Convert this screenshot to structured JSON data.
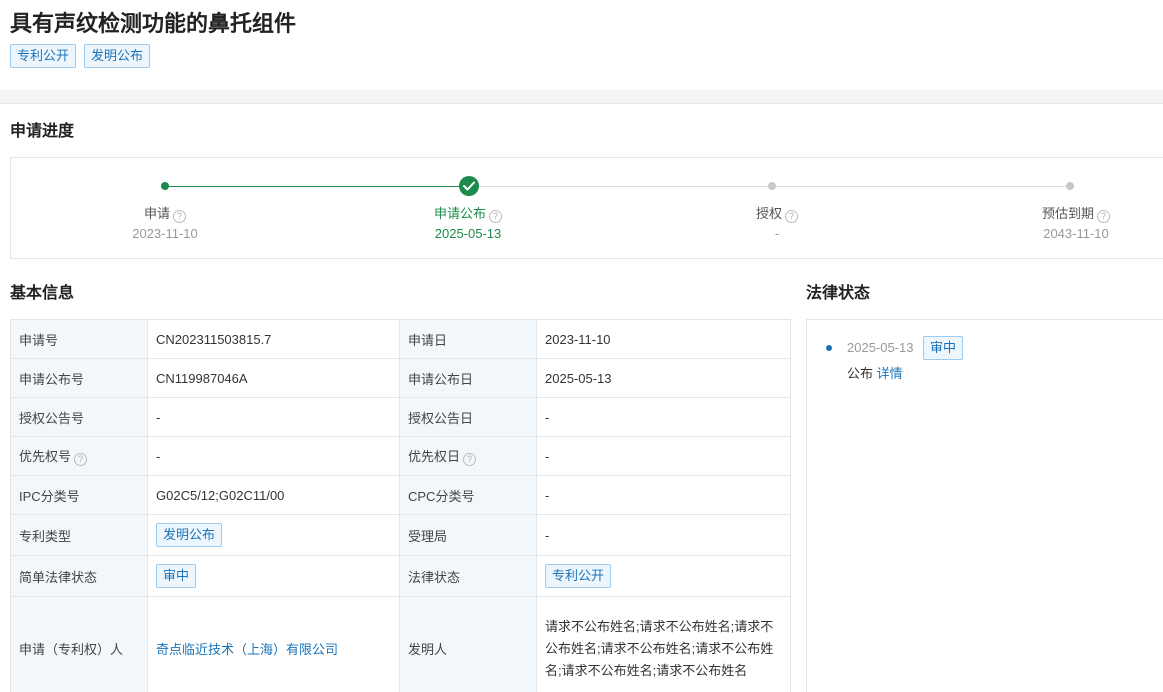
{
  "header": {
    "title": "具有声纹检测功能的鼻托组件",
    "tags": [
      "专利公开",
      "发明公布"
    ]
  },
  "progress": {
    "section_title": "申请进度",
    "steps": [
      {
        "label": "申请",
        "date": "2023-11-10"
      },
      {
        "label": "申请公布",
        "date": "2025-05-13"
      },
      {
        "label": "授权",
        "date": "-"
      },
      {
        "label": "预估到期",
        "date": "2043-11-10"
      }
    ],
    "help_glyph": "?"
  },
  "basic_info": {
    "section_title": "基本信息",
    "rows": [
      {
        "l1": "申请号",
        "v1": "CN202311503815.7",
        "l2": "申请日",
        "v2": "2023-11-10"
      },
      {
        "l1": "申请公布号",
        "v1": "CN119987046A",
        "l2": "申请公布日",
        "v2": "2025-05-13"
      },
      {
        "l1": "授权公告号",
        "v1": "-",
        "l2": "授权公告日",
        "v2": "-"
      },
      {
        "l1": "优先权号",
        "v1": "-",
        "l2": "优先权日",
        "v2": "-"
      },
      {
        "l1": "IPC分类号",
        "v1": "G02C5/12;G02C11/00",
        "l2": "CPC分类号",
        "v2": "-"
      },
      {
        "l1": "专利类型",
        "v1": "发明公布",
        "l2": "受理局",
        "v2": "-"
      },
      {
        "l1": "简单法律状态",
        "v1": "审中",
        "l2": "法律状态",
        "v2": "专利公开"
      },
      {
        "l1": "申请（专利权）人",
        "v1": "奇点临近技术（上海）有限公司",
        "l2": "发明人",
        "v2": "请求不公布姓名;请求不公布姓名;请求不公布姓名;请求不公布姓名;请求不公布姓名;请求不公布姓名;请求不公布姓名"
      }
    ]
  },
  "legal_status": {
    "section_title": "法律状态",
    "events": [
      {
        "date": "2025-05-13",
        "badge": "审中",
        "text": "公布",
        "link": "详情"
      }
    ]
  },
  "colors": {
    "accent": "#1a73b8",
    "success": "#1c8a4a",
    "label_bg": "#f2f7fc"
  }
}
